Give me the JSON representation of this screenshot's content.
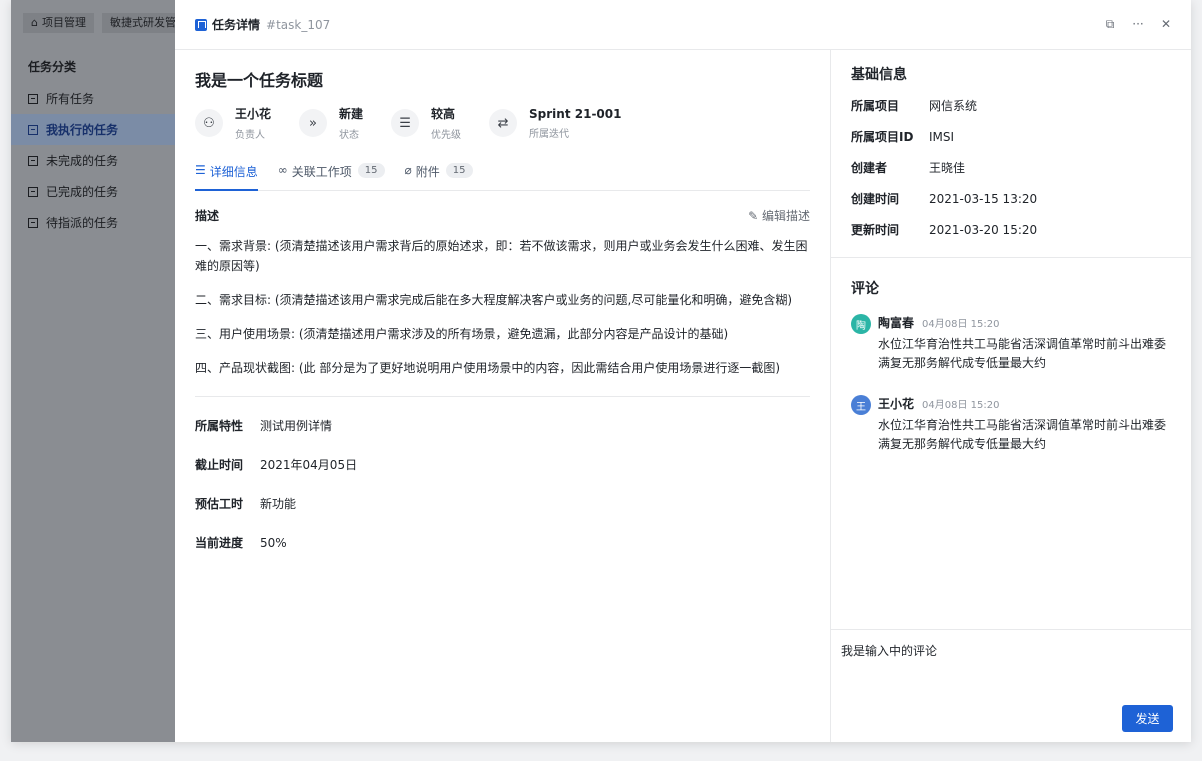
{
  "background_app": {
    "top_chips": [
      {
        "icon": "home-icon",
        "label": "项目管理"
      },
      {
        "label": "敏捷式研发管理"
      }
    ],
    "section_title": "任务分类",
    "nav": [
      {
        "label": "所有任务",
        "active": false
      },
      {
        "label": "我执行的任务",
        "active": true
      },
      {
        "label": "未完成的任务",
        "active": false
      },
      {
        "label": "已完成的任务",
        "active": false
      },
      {
        "label": "待指派的任务",
        "active": false
      }
    ]
  },
  "drawer": {
    "header": {
      "title": "任务详情",
      "id": "#task_107"
    },
    "task_title": "我是一个任务标题",
    "meta": [
      {
        "icon": "user-icon",
        "name": "王小花",
        "sub": "负责人"
      },
      {
        "icon": "status-icon",
        "name": "新建",
        "sub": "状态"
      },
      {
        "icon": "priority-icon",
        "name": "较高",
        "sub": "优先级"
      },
      {
        "icon": "sprint-icon",
        "name": "Sprint 21-001",
        "sub": "所属迭代"
      }
    ],
    "tabs": [
      {
        "label": "详细信息",
        "count": null,
        "active": true
      },
      {
        "label": "关联工作项",
        "count": "15",
        "active": false
      },
      {
        "label": "附件",
        "count": "15",
        "active": false
      }
    ],
    "description": {
      "label": "描述",
      "edit_label": "编辑描述",
      "paragraphs": [
        "一、需求背景: (须清楚描述该用户需求背后的原始述求，即：若不做该需求，则用户或业务会发生什么困难、发生困难的原因等)",
        "二、需求目标: (须清楚描述该用户需求完成后能在多大程度解决客户或业务的问题,尽可能量化和明确，避免含糊)",
        "三、用户使用场景: (须清楚描述用户需求涉及的所有场景，避免遗漏，此部分内容是产品设计的基础)",
        "四、产品现状截图: (此 部分是为了更好地说明用户使用场景中的内容，因此需结合用户使用场景进行逐一截图)"
      ]
    },
    "fields": [
      {
        "key": "所属特性",
        "value": "测试用例详情"
      },
      {
        "key": "截止时间",
        "value": "2021年04月05日"
      },
      {
        "key": "预估工时",
        "value": "新功能"
      },
      {
        "key": "当前进度",
        "value": "50%"
      }
    ],
    "basic_info": {
      "title": "基础信息",
      "rows": [
        {
          "key": "所属项目",
          "value": "网信系统"
        },
        {
          "key": "所属项目ID",
          "value": "IMSI"
        },
        {
          "key": "创建者",
          "value": "王晓佳"
        },
        {
          "key": "创建时间",
          "value": "2021-03-15 13:20"
        },
        {
          "key": "更新时间",
          "value": "2021-03-20 15:20"
        }
      ]
    },
    "comments": {
      "title": "评论",
      "items": [
        {
          "avatar": "陶",
          "avatar_color": "#2bb5a6",
          "name": "陶富春",
          "time": "04月08日 15:20",
          "text": "水位江华育治性共工马能省活深调值革常时前斗出难委满复无那务解代成专低量最大约"
        },
        {
          "avatar": "王",
          "avatar_color": "#4a7fd6",
          "name": "王小花",
          "time": "04月08日 15:20",
          "text": "水位江华育治性共工马能省活深调值革常时前斗出难委满复无那务解代成专低量最大约"
        }
      ]
    },
    "composer": {
      "value": "我是输入中的评论",
      "send_label": "发送"
    }
  },
  "colors": {
    "accent": "#1e62d6",
    "overlay": "#8a8d92"
  }
}
